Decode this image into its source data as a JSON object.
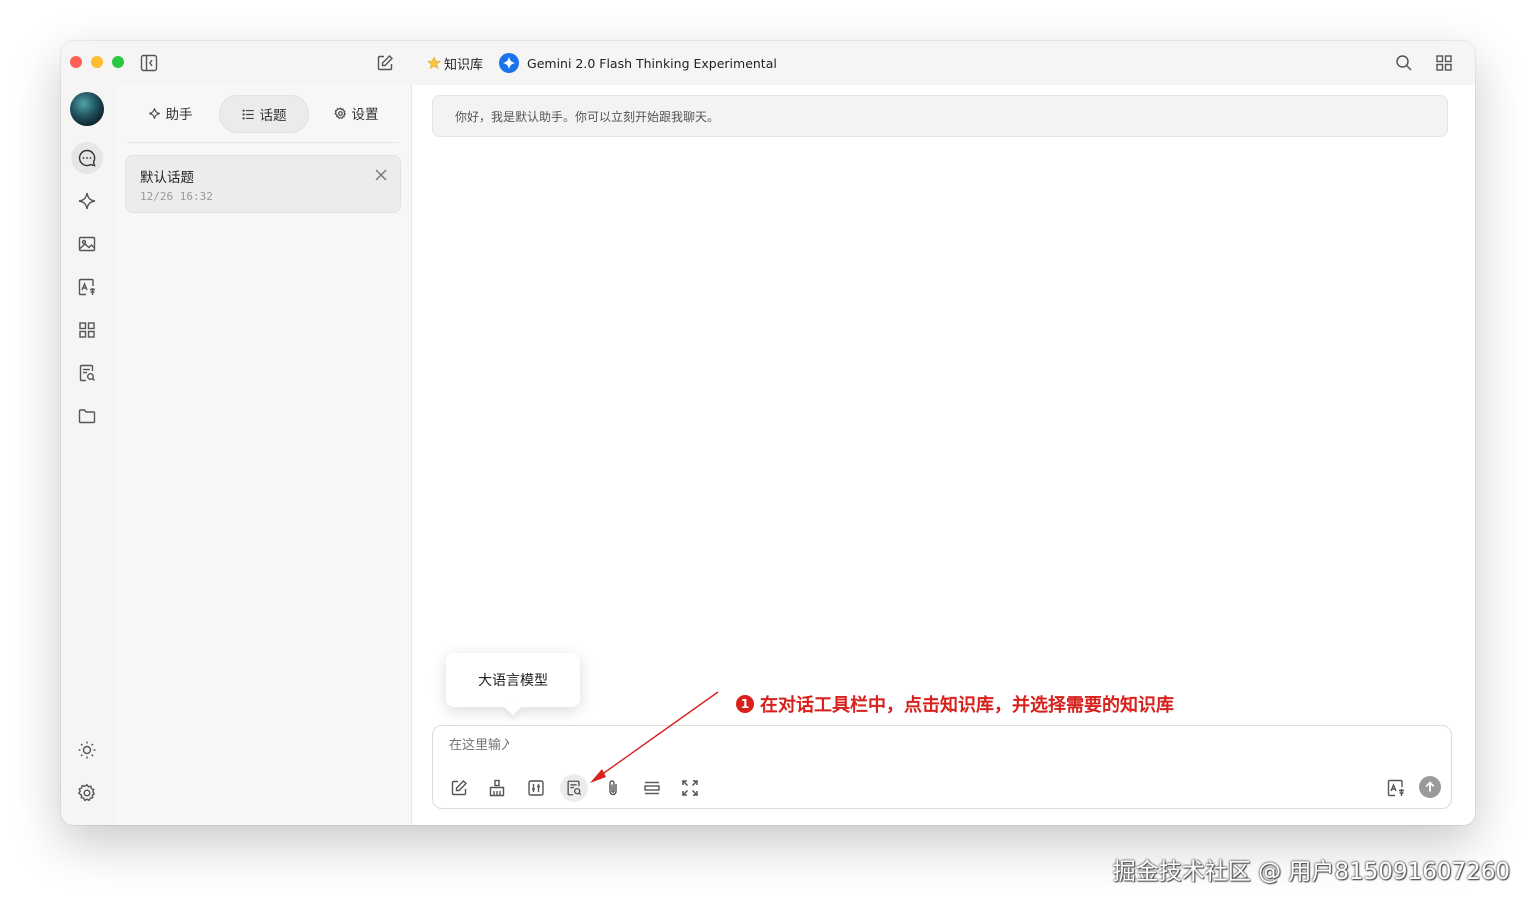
{
  "titlebar": {
    "knowledge_base_label": "知识库",
    "model_name": "Gemini 2.0 Flash Thinking Experimental"
  },
  "sidebar": {
    "tabs": [
      {
        "label": "助手"
      },
      {
        "label": "话题"
      },
      {
        "label": "设置"
      }
    ],
    "topics": [
      {
        "title": "默认话题",
        "time": "12/26 16:32"
      }
    ]
  },
  "chat": {
    "greeting": "你好，我是默认助手。你可以立刻开始跟我聊天。"
  },
  "composer": {
    "placeholder": "在这里输入消息..."
  },
  "tooltip": {
    "text": "大语言模型"
  },
  "annotation": {
    "number": "1",
    "text": "在对话工具栏中，点击知识库，并选择需要的知识库"
  },
  "watermark": "掘金技术社区 @ 用户815091607260",
  "colors": {
    "accent": "#d8201c",
    "gemini_blue": "#1a73e8"
  }
}
